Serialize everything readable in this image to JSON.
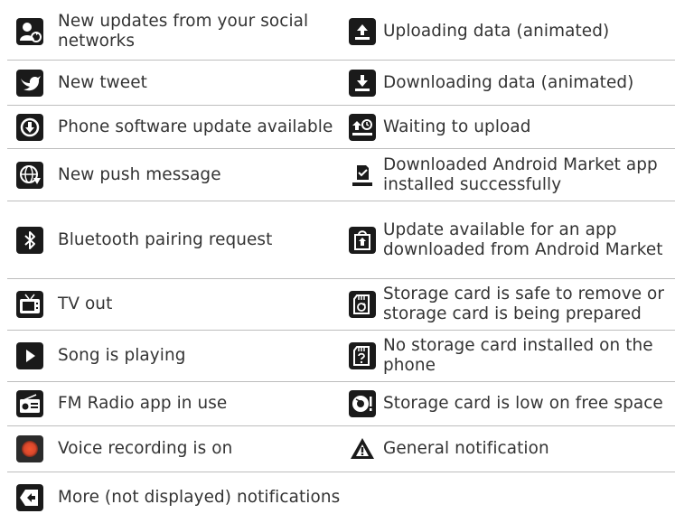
{
  "rows": [
    {
      "left": {
        "icon": "social-update-icon",
        "label": "New updates from your social networks"
      },
      "right": {
        "icon": "upload-icon",
        "label": "Uploading data (animated)"
      }
    },
    {
      "left": {
        "icon": "tweet-bird-icon",
        "label": "New tweet"
      },
      "right": {
        "icon": "download-icon",
        "label": "Downloading data (animated)"
      }
    },
    {
      "left": {
        "icon": "software-update-icon",
        "label": "Phone software update available"
      },
      "right": {
        "icon": "waiting-upload-icon",
        "label": "Waiting to upload"
      }
    },
    {
      "left": {
        "icon": "push-message-icon",
        "label": "New push message"
      },
      "right": {
        "icon": "market-installed-icon",
        "label": "Downloaded Android Market app installed successfully"
      }
    },
    {
      "left": {
        "icon": "bluetooth-icon",
        "label": "Bluetooth pairing request"
      },
      "right": {
        "icon": "market-update-icon",
        "label": "Update available for an app downloaded from Android Market"
      }
    },
    {
      "left": {
        "icon": "tv-out-icon",
        "label": "TV out"
      },
      "right": {
        "icon": "storage-safe-icon",
        "label": "Storage card is safe to remove or storage card is being prepared"
      }
    },
    {
      "left": {
        "icon": "song-playing-icon",
        "label": "Song is playing"
      },
      "right": {
        "icon": "no-storage-icon",
        "label": "No storage card installed on the phone"
      }
    },
    {
      "left": {
        "icon": "fm-radio-icon",
        "label": "FM Radio app in use"
      },
      "right": {
        "icon": "storage-low-icon",
        "label": "Storage card is low on free space"
      }
    },
    {
      "left": {
        "icon": "voice-recording-icon",
        "label": "Voice recording is on"
      },
      "right": {
        "icon": "general-notification-icon",
        "label": "General notification"
      }
    },
    {
      "left": {
        "icon": "more-notifications-icon",
        "label": "More (not displayed) notifications"
      }
    }
  ],
  "colors": {
    "icon_bg": "#1a1a1a",
    "divider": "#bdbdbd",
    "text": "#333333",
    "recording_red": "#d9472b"
  }
}
